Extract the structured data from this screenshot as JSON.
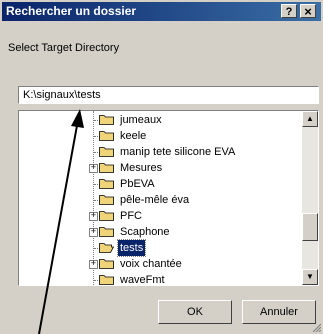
{
  "dialog": {
    "title": "Rechercher un dossier",
    "help_label": "?",
    "close_label": "×",
    "description": "Select Target Directory",
    "path_value": "K:\\signaux\\tests"
  },
  "tree": {
    "items": [
      {
        "label": "jumeaux",
        "expander": ""
      },
      {
        "label": "keele",
        "expander": ""
      },
      {
        "label": "manip tete silicone EVA",
        "expander": ""
      },
      {
        "label": "Mesures",
        "expander": "+"
      },
      {
        "label": "PbEVA",
        "expander": ""
      },
      {
        "label": "pêle-mêle éva",
        "expander": ""
      },
      {
        "label": "PFC",
        "expander": "+"
      },
      {
        "label": "Scaphone",
        "expander": "+"
      },
      {
        "label": "tests",
        "expander": "",
        "selected": true
      },
      {
        "label": "voix chantée",
        "expander": "+"
      },
      {
        "label": "waveFmt",
        "expander": ""
      }
    ]
  },
  "buttons": {
    "ok_label": "OK",
    "cancel_label": "Annuler"
  },
  "colors": {
    "titlebar_start": "#0a246a",
    "titlebar_end": "#3a6ea5",
    "selection": "#0a246a",
    "folder": "#f0d47a",
    "annotation_arrow": "#000000"
  }
}
